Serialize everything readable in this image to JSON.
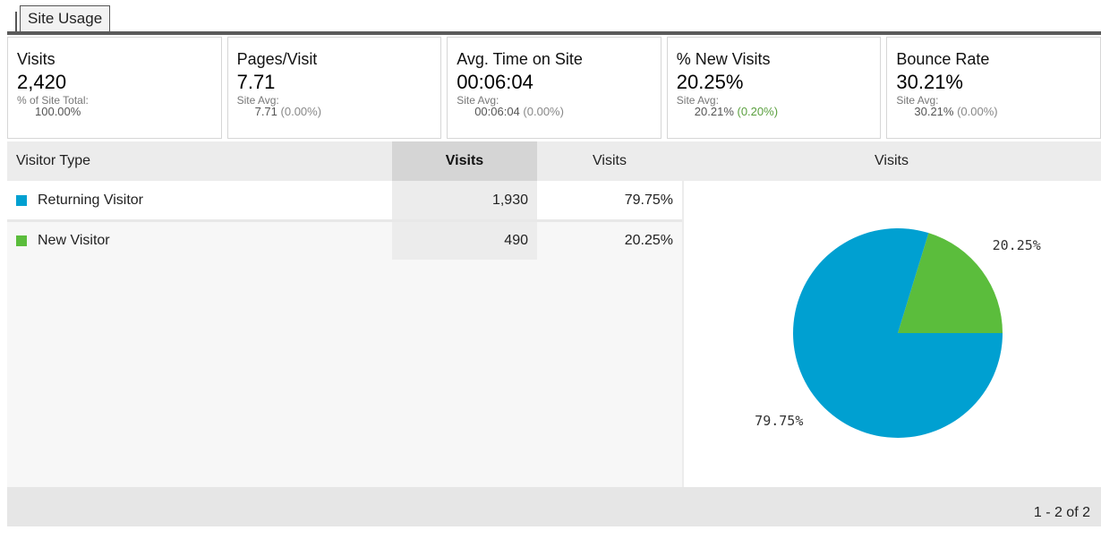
{
  "tab": {
    "label": "Site Usage"
  },
  "scorecards": [
    {
      "label": "Visits",
      "value": "2,420",
      "sub1": "% of Site Total:",
      "sub2": "100.00%",
      "delta": ""
    },
    {
      "label": "Pages/Visit",
      "value": "7.71",
      "sub1": "Site Avg:",
      "sub2": "7.71",
      "delta": "(0.00%)"
    },
    {
      "label": "Avg. Time on Site",
      "value": "00:06:04",
      "sub1": "Site Avg:",
      "sub2": "00:06:04",
      "delta": "(0.00%)"
    },
    {
      "label": "% New Visits",
      "value": "20.25%",
      "sub1": "Site Avg:",
      "sub2": "20.21%",
      "delta": "(0.20%)"
    },
    {
      "label": "Bounce Rate",
      "value": "30.21%",
      "sub1": "Site Avg:",
      "sub2": "30.21%",
      "delta": "(0.00%)"
    }
  ],
  "table": {
    "headers": {
      "type": "Visitor Type",
      "visits_count": "Visits",
      "visits_pct": "Visits",
      "visits_chart": "Visits"
    },
    "rows": [
      {
        "type": "Returning Visitor",
        "visits": "1,930",
        "pct": "79.75%",
        "color": "#00a0d1"
      },
      {
        "type": "New Visitor",
        "visits": "490",
        "pct": "20.25%",
        "color": "#5bbd3c"
      }
    ],
    "pagination": "1 - 2 of 2"
  },
  "chart_data": {
    "type": "pie",
    "categories": [
      "Returning Visitor",
      "New Visitor"
    ],
    "values": [
      79.75,
      20.25
    ],
    "labels": [
      "79.75%",
      "20.25%"
    ],
    "colors": [
      "#00a0d1",
      "#5bbd3c"
    ],
    "title": ""
  }
}
